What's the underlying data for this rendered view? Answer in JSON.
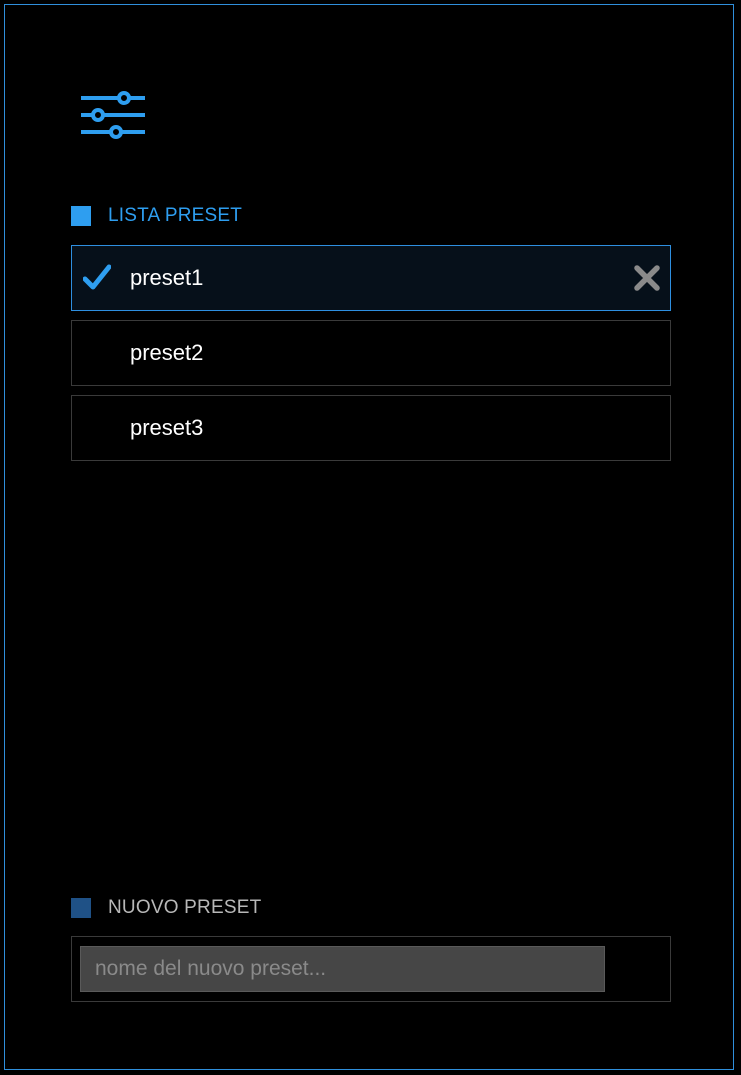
{
  "icons": {
    "settings": "sliders-icon",
    "check": "checkmark-icon",
    "delete": "close-x-icon"
  },
  "colors": {
    "accent": "#2e9ef0",
    "accent_dark": "#1f5186",
    "background": "#000000",
    "border": "#3a3a3a",
    "input_bg": "#464646"
  },
  "preset_list": {
    "header": "LISTA PRESET",
    "items": [
      {
        "label": "preset1",
        "selected": true
      },
      {
        "label": "preset2",
        "selected": false
      },
      {
        "label": "preset3",
        "selected": false
      }
    ]
  },
  "new_preset": {
    "header": "NUOVO PRESET",
    "input_value": "",
    "input_placeholder": "nome del nuovo preset..."
  }
}
